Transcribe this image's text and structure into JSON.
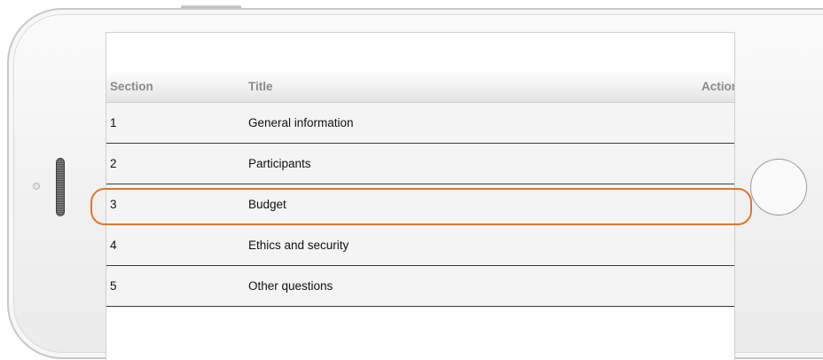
{
  "table": {
    "headers": {
      "section": "Section",
      "title": "Title",
      "action": "Action"
    },
    "rows": [
      {
        "section": "1",
        "title": "General information",
        "action": ""
      },
      {
        "section": "2",
        "title": "Participants",
        "action": ""
      },
      {
        "section": "3",
        "title": "Budget",
        "action": ""
      },
      {
        "section": "4",
        "title": "Ethics and security",
        "action": ""
      },
      {
        "section": "5",
        "title": "Other questions",
        "action": ""
      }
    ]
  },
  "highlight": {
    "color": "#e2742e",
    "row_index": 2
  },
  "colors": {
    "header_text": "#8a8a8a",
    "row_background": "#f4f4f4",
    "row_divider": "#3a3a3a"
  }
}
